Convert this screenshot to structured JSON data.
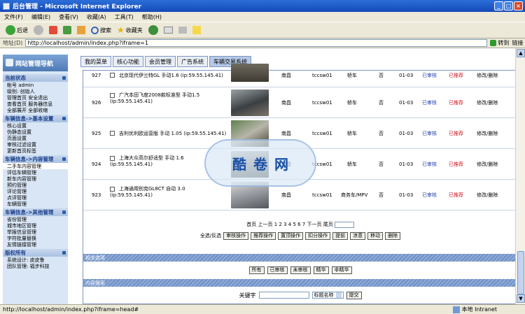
{
  "window": {
    "title": "后台管理 - Microsoft Internet Explorer",
    "buttons": [
      "_",
      "□",
      "×"
    ]
  },
  "menu": [
    "文件(F)",
    "编辑(E)",
    "查看(V)",
    "收藏(A)",
    "工具(T)",
    "帮助(H)"
  ],
  "toolbar": {
    "back": "后退",
    "search": "搜索",
    "favorites": "收藏夹"
  },
  "address": {
    "label": "地址(D)",
    "url": "http://localhost/admin/index.php?iframe=1",
    "go": "转到",
    "links": "链接"
  },
  "sidebar": {
    "title": "网站管理导航",
    "sections": [
      {
        "title": "当前状态",
        "items": [
          "帐号 admin",
          "级别: 创始人",
          "管理首页  安全退出",
          "查看首页  服务器信息",
          "全部展开  全部收缩"
        ]
      },
      {
        "title": "车辆信息->基本设置",
        "items": [
          "核心设置",
          "伪静态设置",
          "页面设置",
          "审核过滤设置",
          "更新首页标签"
        ]
      },
      {
        "title": "车辆信息->内容管理",
        "items": [
          "二手车内容管理",
          "评估车辆管理",
          "新车内容管理",
          "预约管理",
          "评论管理",
          "点评管理",
          "车辆管理"
        ]
      },
      {
        "title": "车辆信息->其他管理",
        "items": [
          "省份管理",
          "城市地区管理",
          "举报信息管理",
          "字符批量替换",
          "友情链接管理"
        ]
      },
      {
        "title": "版权所有",
        "items": [
          "系统设计: 皮皮鲁",
          "团队管理: 福步科技"
        ]
      }
    ]
  },
  "tabs": [
    "我的菜单",
    "核心功能",
    "会员管理",
    "广告系统",
    "车辆交易系统"
  ],
  "rows": [
    {
      "id": "927",
      "title": "北京现代伊兰特GL 手动1.6",
      "ip": "(ip:59.55.145.41)",
      "city": "南昌",
      "user": "tccsw01",
      "type": "轿车",
      "flag": "否",
      "date": "01-03",
      "status": "已审核",
      "rec": "已推荐",
      "ops": "修改/删除"
    },
    {
      "id": "926",
      "title": "广汽本田飞度2008款标准型 手动1.5",
      "ip": "(ip:59.55.145.41)",
      "city": "南昌",
      "user": "tccsw01",
      "type": "轿车",
      "flag": "否",
      "date": "01-03",
      "status": "已审核",
      "rec": "已推荐",
      "ops": "修改/删除"
    },
    {
      "id": "925",
      "title": "吉利优利欧运营版 手动 1.05",
      "ip": "(ip:59.55.145.41)",
      "city": "南昌",
      "user": "tccsw01",
      "type": "轿车",
      "flag": "否",
      "date": "01-03",
      "status": "已审核",
      "rec": "已推荐",
      "ops": "修改/删除"
    },
    {
      "id": "924",
      "title": "上海大众高尔舒适型 手动 1.6",
      "ip": "(ip:59.55.145.41)",
      "city": "南昌",
      "user": "tccsw01",
      "type": "轿车",
      "flag": "否",
      "date": "01-03",
      "status": "已审核",
      "rec": "已推荐",
      "ops": "修改/删除"
    },
    {
      "id": "923",
      "title": "上海通用别克GL8CT 自动 3.0",
      "ip": "(ip:59.55.145.41)",
      "city": "南昌",
      "user": "tccsw01",
      "type": "商务车/MPV",
      "flag": "否",
      "date": "01-03",
      "status": "已审核",
      "rec": "已推荐",
      "ops": "修改/删除"
    }
  ],
  "pager": {
    "text": "首页 上一页 1 2 3 4 5 6 7 下一页 尾页"
  },
  "actions": {
    "select": "全选/反选",
    "buttons": [
      "审核操作",
      "推荐操作",
      "置顶操作",
      "扣分操作",
      "提前",
      "凉意",
      "移动",
      "删除"
    ]
  },
  "related": {
    "title": "相关选项",
    "buttons": [
      "所有",
      "已审核",
      "未审核",
      "精华",
      "非精华"
    ]
  },
  "search": {
    "title": "内容搜索",
    "keyword_label": "关键字",
    "select": "标题名称",
    "submit": "提交"
  },
  "status": {
    "url": "http://localhost/admin/index.php?iframe=head#",
    "zone": "本地 Intranet"
  },
  "watermark": [
    "酷",
    "卷",
    "网"
  ]
}
